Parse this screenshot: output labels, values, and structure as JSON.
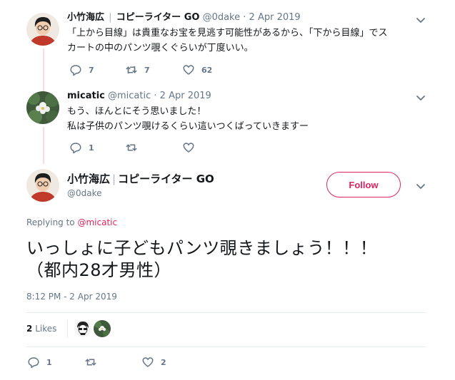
{
  "tweets": [
    {
      "name": "小竹海広",
      "separator": "|",
      "tagline": "コピーライター GO",
      "handle": "@0dake",
      "dot": "·",
      "date": "2 Apr 2019",
      "text_line1": "「上から目線」は貴重なお宝を見逃す可能性があるから、「下から目線」でス",
      "text_line2": "カートの中のパンツ覗くぐらいが丁度いい。",
      "replies": "7",
      "retweets": "7",
      "likes": "62"
    },
    {
      "name": "micatic",
      "handle": "@micatic",
      "dot": "·",
      "date": "2 Apr 2019",
      "text_line1": "もう、ほんとにそう思いました！",
      "text_line2": "私は子供のパンツ覗けるくらい這いつくばっていきますー",
      "replies": "1",
      "retweets": "",
      "likes": ""
    }
  ],
  "main": {
    "name": "小竹海広",
    "separator": "|",
    "tagline": "コピーライター GO",
    "handle": "@0dake",
    "follow_label": "Follow",
    "replying_prefix": "Replying to",
    "replying_handle": "@micatic",
    "text_line1": "いっしょに子どもパンツ覗きましょう！！！",
    "text_line2": "（都内28才男性）",
    "timestamp": "8:12 PM - 2 Apr 2019",
    "likes_count": "2",
    "likes_label": "Likes",
    "replies": "1",
    "retweets": "",
    "likes": "2"
  },
  "colors": {
    "accent": "#e0245e",
    "thread_line": "#fadbe6",
    "muted": "#657786",
    "divider": "#e6ecf0"
  },
  "icons": [
    "reply-icon",
    "retweet-icon",
    "heart-icon",
    "chevron-down-icon"
  ]
}
